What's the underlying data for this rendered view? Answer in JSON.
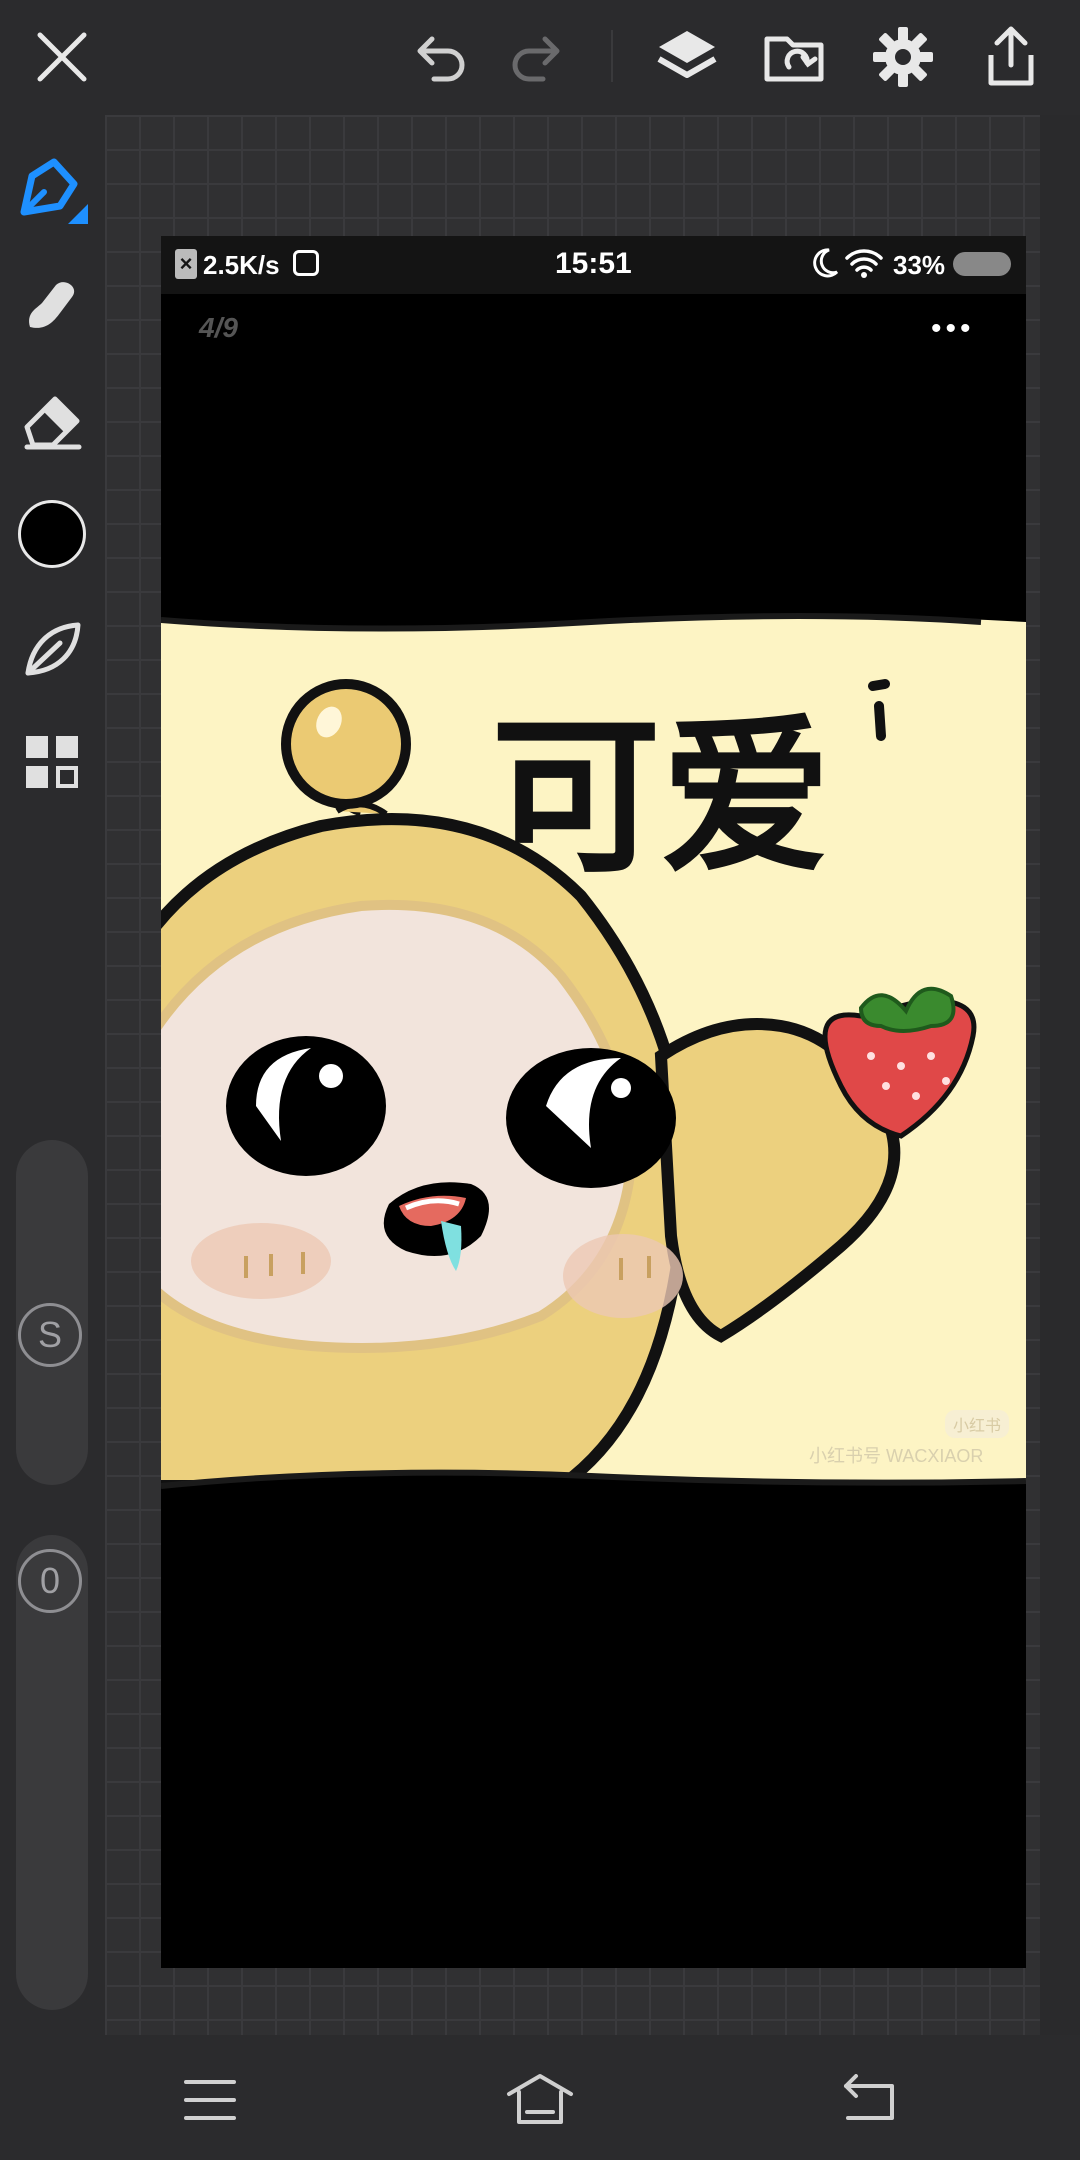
{
  "toolbar": {
    "icons": [
      "close-icon",
      "undo-icon",
      "redo-icon",
      "layers-icon",
      "import-icon",
      "settings-icon",
      "share-icon"
    ]
  },
  "sidebar": {
    "tools": [
      "pen-icon",
      "smudge-icon",
      "eraser-icon",
      "color-swatch",
      "leaf-brush-icon",
      "gallery-icon"
    ],
    "current_color": "#000000",
    "accent": "#1e90ff",
    "size_label": "S",
    "opacity_label": "0"
  },
  "artwork": {
    "status": {
      "speed": "2.5K/s",
      "time": "15:51",
      "battery": "33%"
    },
    "page_counter": "4/9",
    "more": "•••",
    "title_glyphs": "可爱",
    "watermark_badge": "小红书",
    "watermark_text": "小红书号 WACXIAOR"
  },
  "nav": {
    "icons": [
      "menu-icon",
      "home-icon",
      "back-icon"
    ]
  }
}
